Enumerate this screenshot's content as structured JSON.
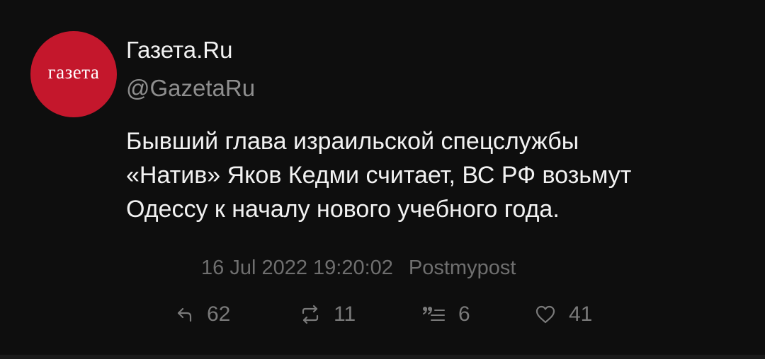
{
  "tweet": {
    "avatar": {
      "text": "газета",
      "bg_color": "#c4172c"
    },
    "display_name": "Газета.Ru",
    "handle": "@GazetaRu",
    "text_lines": [
      "Бывший глава израильской спецслужбы",
      "«Натив» Яков Кедми считает, ВС РФ возьмут",
      "Одессу к началу нового учебного года."
    ],
    "timestamp": "16 Jul 2022 19:20:02",
    "source": "Postmypost",
    "actions": {
      "replies": {
        "icon": "reply-icon",
        "count": "62"
      },
      "retweets": {
        "icon": "retweet-icon",
        "count": "11"
      },
      "quotes": {
        "icon": "quote-icon",
        "count": "6"
      },
      "likes": {
        "icon": "heart-icon",
        "count": "41"
      }
    }
  },
  "colors": {
    "background": "#0e0e0e",
    "text_primary": "#f2f2f2",
    "text_secondary": "#8e8e8e",
    "meta": "#6f6f6f"
  }
}
